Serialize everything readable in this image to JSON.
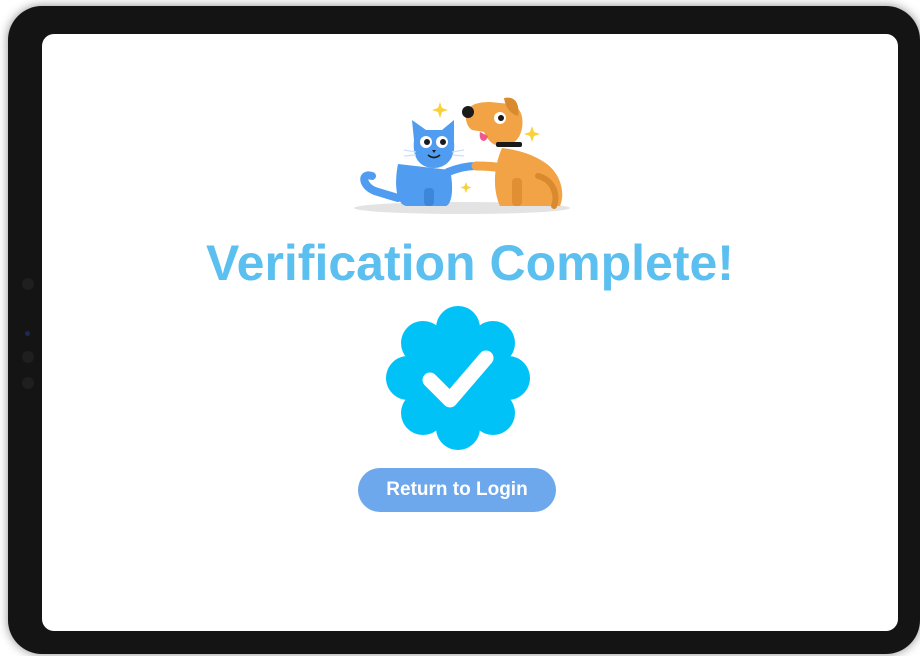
{
  "screen": {
    "title": "Verification Complete!",
    "button_label": "Return to Login"
  },
  "icons": {
    "illustration": "cat-and-dog-illustration",
    "badge": "verified-check-badge-icon"
  },
  "colors": {
    "title": "#5bbfef",
    "badge": "#00c2f7",
    "button": "#6ea8ec",
    "cat": "#4f9cf0",
    "dog": "#f2a346"
  }
}
